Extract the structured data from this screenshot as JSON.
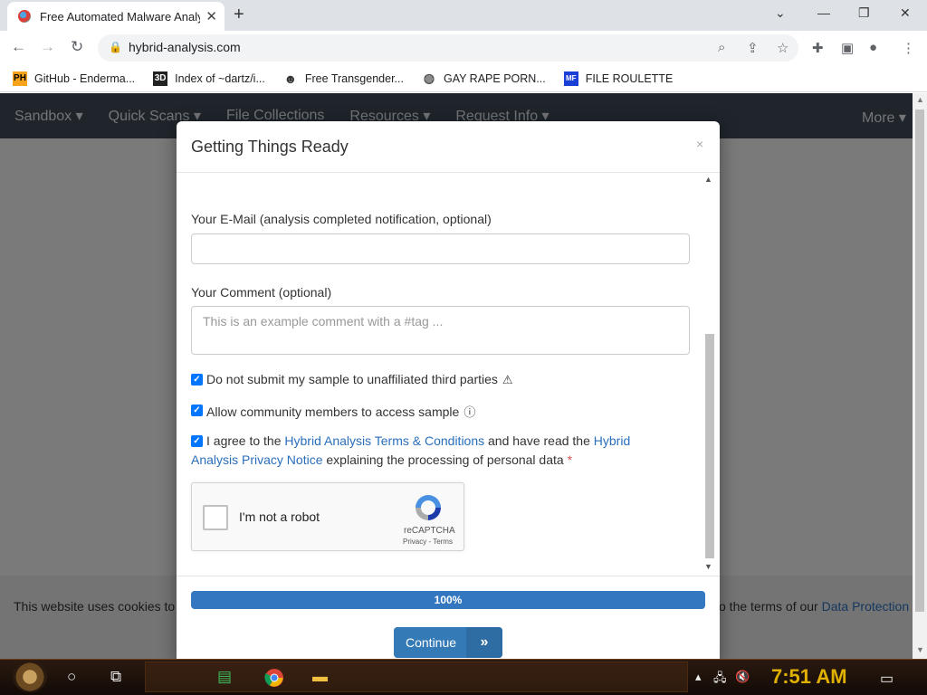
{
  "browser": {
    "tab_title": "Free Automated Malware Analy",
    "url": "hybrid-analysis.com",
    "bookmarks": [
      {
        "icon": "PH",
        "label": "GitHub - Enderma..."
      },
      {
        "icon": "3D",
        "label": "Index of ~dartz/i..."
      },
      {
        "icon": "",
        "label": "Free Transgender..."
      },
      {
        "icon": "",
        "label": "GAY RAPE PORN..."
      },
      {
        "icon": "MF",
        "label": "FILE ROULETTE"
      }
    ]
  },
  "site_nav": {
    "items": [
      "Sandbox ▾",
      "Quick Scans ▾",
      "File Collections",
      "Resources ▾",
      "Request Info ▾"
    ],
    "more": "More ▾"
  },
  "cookie": {
    "left_text": "This website uses cookies to",
    "right_text": "o the terms of our ",
    "link": "Data Protection"
  },
  "modal": {
    "title": "Getting Things Ready",
    "close": "×",
    "email_label": "Your E-Mail (analysis completed notification, optional)",
    "email_value": "",
    "comment_label": "Your Comment (optional)",
    "comment_placeholder": "This is an example comment with a #tag ...",
    "checkbox1": "Do not submit my sample to unaffiliated third parties",
    "checkbox2": "Allow community members to access sample",
    "agree_pre": "I agree to the ",
    "agree_link1": "Hybrid Analysis Terms & Conditions",
    "agree_mid": " and have read the ",
    "agree_link2": "Hybrid Analysis Privacy Notice",
    "agree_post": " explaining the processing of personal data ",
    "agree_req": "*",
    "recaptcha_label": "I'm not a robot",
    "recaptcha_brand": "reCAPTCHA",
    "recaptcha_links": "Privacy - Terms",
    "progress_percent": 100,
    "progress_label": "100%",
    "continue_label": "Continue",
    "continue_arrow": "»"
  },
  "taskbar": {
    "clock": "7:51 AM"
  }
}
